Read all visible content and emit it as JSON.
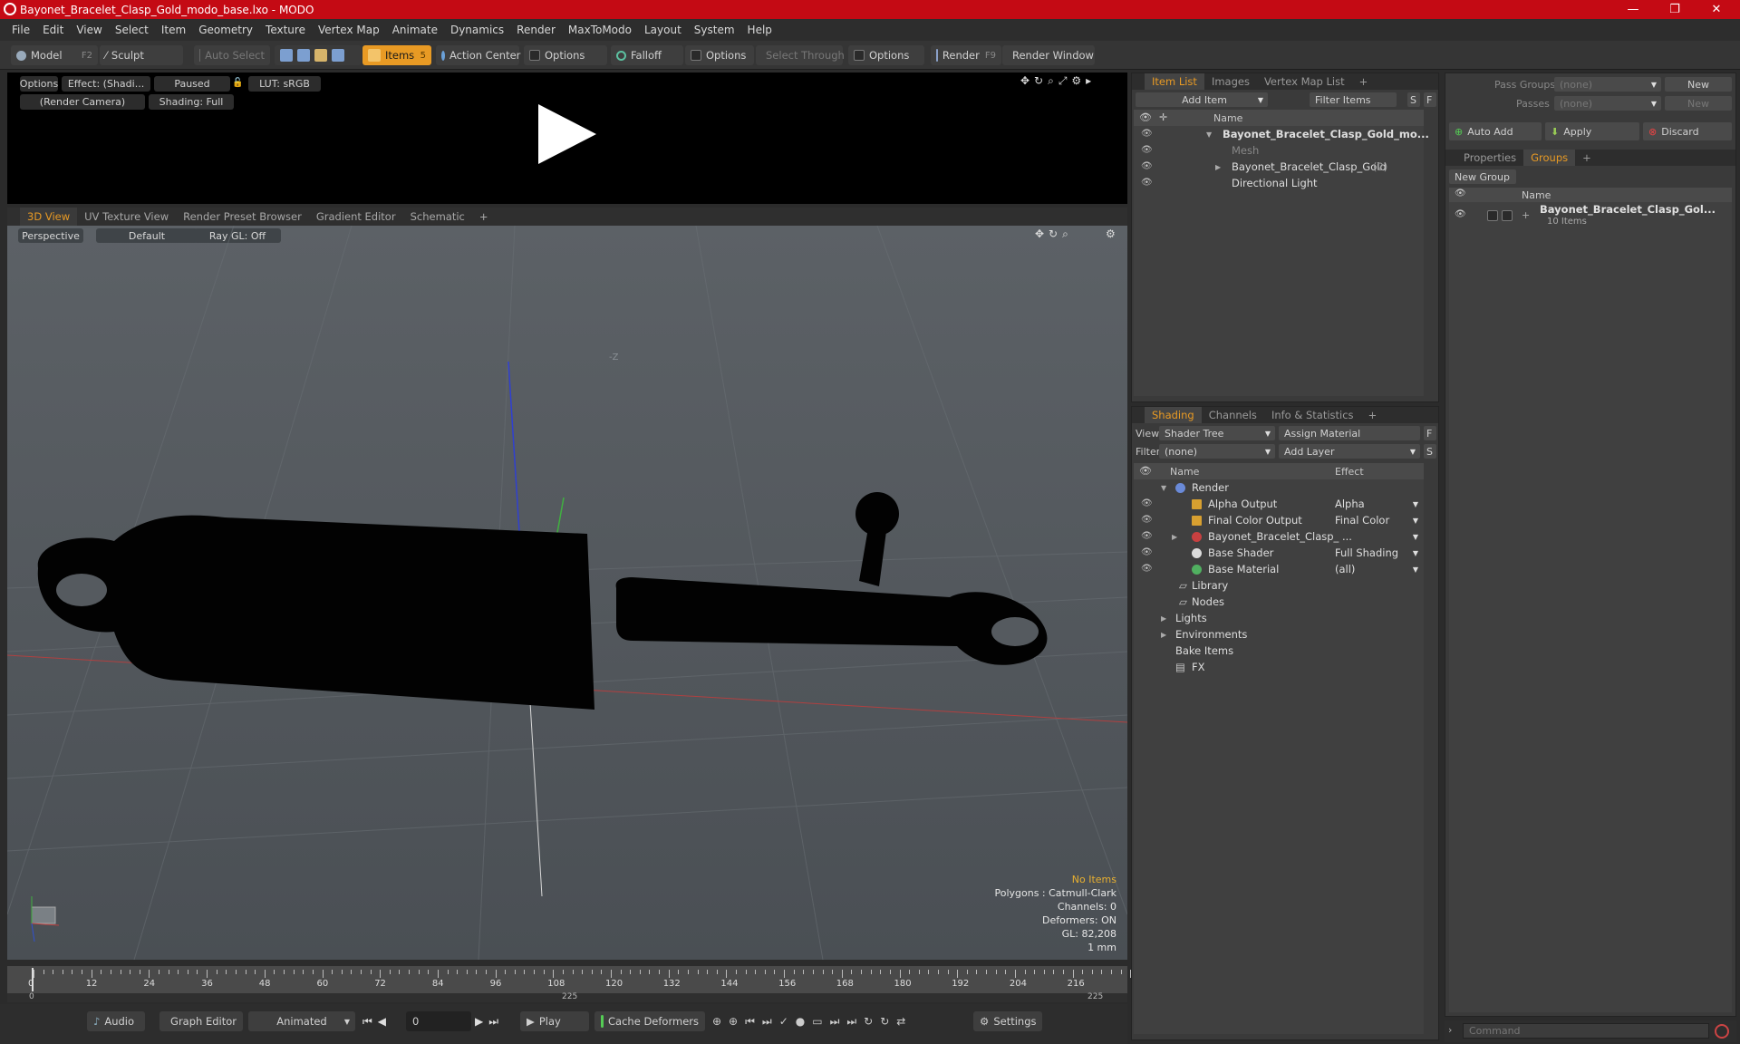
{
  "window": {
    "title": "Bayonet_Bracelet_Clasp_Gold_modo_base.lxo - MODO",
    "min": "—",
    "max": "❐",
    "close": "✕"
  },
  "menu": [
    "File",
    "Edit",
    "View",
    "Select",
    "Item",
    "Geometry",
    "Texture",
    "Vertex Map",
    "Animate",
    "Dynamics",
    "Render",
    "MaxToModo",
    "Layout",
    "System",
    "Help"
  ],
  "toolbar": {
    "model": "Model",
    "model_key": "F2",
    "sculpt": "Sculpt",
    "auto_select": "Auto Select",
    "items": "Items",
    "items_key": "5",
    "action_center": "Action Center",
    "options1": "Options",
    "falloff": "Falloff",
    "options2": "Options",
    "select_through": "Select Through",
    "options3": "Options",
    "render": "Render",
    "render_key": "F9",
    "render_window": "Render Window"
  },
  "preview": {
    "options": "Options",
    "effect": "Effect: (Shadi...",
    "paused": "Paused",
    "lut": "LUT: sRGB",
    "camera": "(Render Camera)",
    "shading": "Shading: Full"
  },
  "view_tabs": [
    "3D View",
    "UV Texture View",
    "Render Preset Browser",
    "Gradient Editor",
    "Schematic",
    "+"
  ],
  "viewport": {
    "perspective": "Perspective",
    "default": "Default",
    "raygl": "Ray GL: Off",
    "axis_label": "-Z",
    "info": {
      "no_items": "No Items",
      "polygons": "Polygons : Catmull-Clark",
      "channels": "Channels: 0",
      "deformers": "Deformers: ON",
      "gl": "GL: 82,208",
      "unit": "1 mm"
    }
  },
  "timeline": {
    "ticks": [
      "0",
      "12",
      "24",
      "36",
      "48",
      "60",
      "72",
      "84",
      "96",
      "108",
      "120",
      "132",
      "144",
      "156",
      "168",
      "180",
      "192",
      "204",
      "216"
    ],
    "start": "0",
    "mid": "225",
    "end": "225"
  },
  "bottom": {
    "audio": "Audio",
    "graph_editor": "Graph Editor",
    "animated": "Animated",
    "frame": "0",
    "play": "Play",
    "cache": "Cache Deformers",
    "settings": "Settings"
  },
  "item_list": {
    "tabs": [
      "Item List",
      "Images",
      "Vertex Map List",
      "+"
    ],
    "add_item": "Add Item",
    "filter": "Filter Items",
    "s": "S",
    "f": "F",
    "col_name": "Name",
    "rows": [
      {
        "label": "Bayonet_Bracelet_Clasp_Gold_mo...",
        "count": ""
      },
      {
        "label": "Mesh",
        "count": ""
      },
      {
        "label": "Bayonet_Bracelet_Clasp_Gold",
        "count": "(2)"
      },
      {
        "label": "Directional Light",
        "count": ""
      }
    ]
  },
  "shading": {
    "tabs": [
      "Shading",
      "Channels",
      "Info & Statistics",
      "+"
    ],
    "view_label": "View",
    "view_value": "Shader Tree",
    "assign": "Assign Material",
    "f": "F",
    "filter_label": "Filter",
    "filter_value": "(none)",
    "add_layer": "Add Layer",
    "s": "S",
    "col_name": "Name",
    "col_effect": "Effect",
    "rows": [
      {
        "name": "Render",
        "effect": ""
      },
      {
        "name": "Alpha Output",
        "effect": "Alpha"
      },
      {
        "name": "Final Color Output",
        "effect": "Final Color"
      },
      {
        "name": "Bayonet_Bracelet_Clasp_ ...",
        "effect": ""
      },
      {
        "name": "Base Shader",
        "effect": "Full Shading"
      },
      {
        "name": "Base Material",
        "effect": "(all)"
      },
      {
        "name": "Library",
        "effect": ""
      },
      {
        "name": "Nodes",
        "effect": ""
      },
      {
        "name": "Lights",
        "effect": ""
      },
      {
        "name": "Environments",
        "effect": ""
      },
      {
        "name": "Bake Items",
        "effect": ""
      },
      {
        "name": "FX",
        "effect": ""
      }
    ]
  },
  "groups": {
    "pass_groups": "Pass Groups",
    "pass_groups_value": "(none)",
    "new": "New",
    "passes": "Passes",
    "passes_value": "(none)",
    "new2": "New",
    "auto_add": "Auto Add",
    "apply": "Apply",
    "discard": "Discard",
    "tabs": [
      "Properties",
      "Groups",
      "+"
    ],
    "new_group": "New Group",
    "col_name": "Name",
    "group_name": "Bayonet_Bracelet_Clasp_Gol...",
    "group_count": "10 Items"
  },
  "command": {
    "placeholder": "Command"
  },
  "colors": {
    "accent": "#e89a24",
    "titlebar": "#c40a14"
  }
}
